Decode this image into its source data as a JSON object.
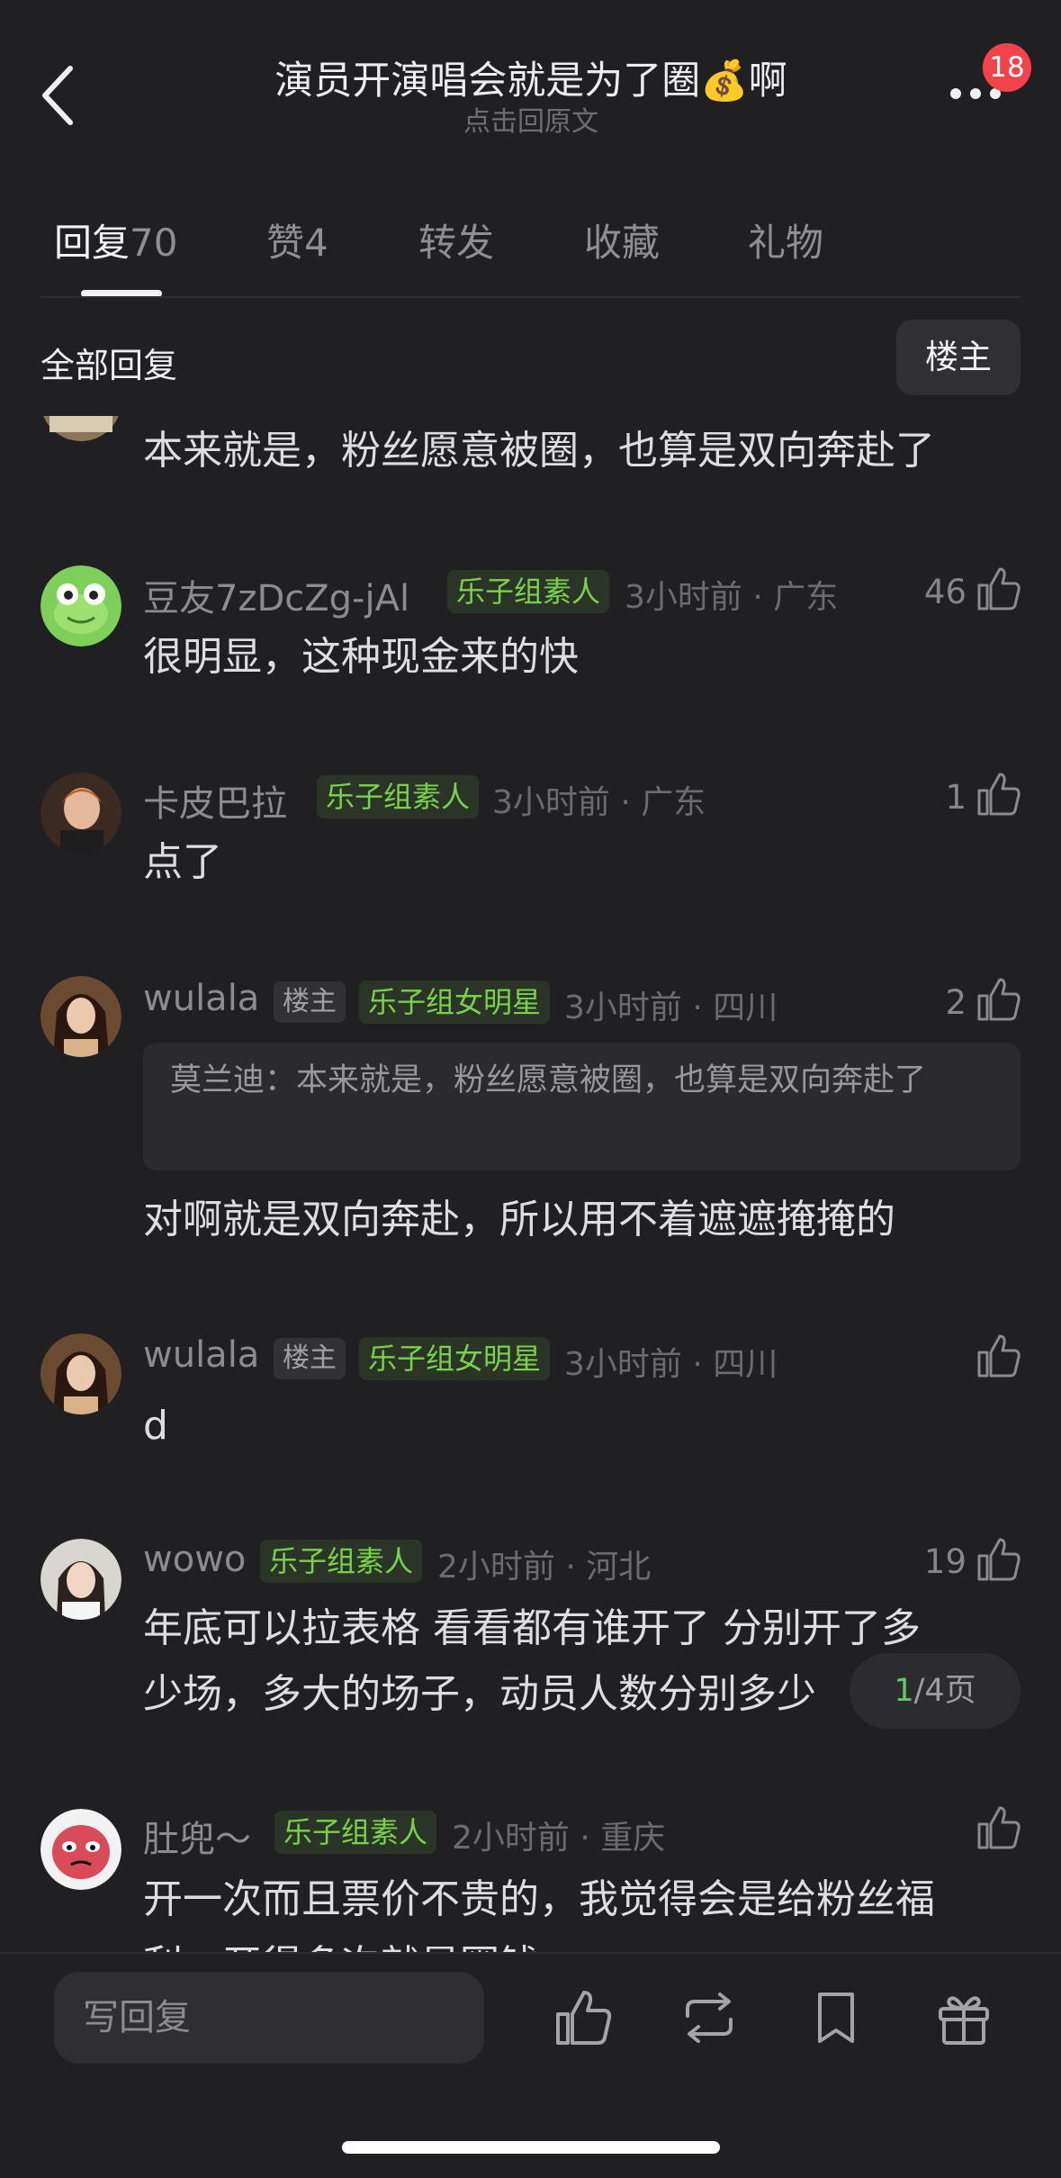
{
  "header": {
    "title": "演员开演唱会就是为了圈💰啊",
    "subtitle": "点击回原文",
    "notification_count": "18"
  },
  "tabs": [
    {
      "label": "回复",
      "count": "70",
      "active": true
    },
    {
      "label": "赞",
      "count": "4",
      "active": false
    },
    {
      "label": "转发",
      "count": "",
      "active": false
    },
    {
      "label": "收藏",
      "count": "",
      "active": false
    },
    {
      "label": "礼物",
      "count": "",
      "active": false
    }
  ],
  "section": {
    "title": "全部回复",
    "op_filter_label": "楼主"
  },
  "comments": [
    {
      "user": "",
      "text": "本来就是，粉丝愿意被圈，也算是双向奔赴了",
      "avatar": "partial-avatar"
    },
    {
      "user": "豆友7zDcZg-jAl",
      "tag": "乐子组素人",
      "meta": "3小时前 · 广东",
      "likes": "46",
      "text": "很明显，这种现金来的快",
      "avatar": "frog-avatar"
    },
    {
      "user": "卡皮巴拉",
      "tag": "乐子组素人",
      "meta": "3小时前 · 广东",
      "likes": "1",
      "text": "点了",
      "avatar": "photo-avatar"
    },
    {
      "user": "wulala",
      "op_tag": "楼主",
      "tag": "乐子组女明星",
      "meta": "3小时前 · 四川",
      "likes": "2",
      "quote": "莫兰迪：本来就是，粉丝愿意被圈，也算是双向奔赴了",
      "text": "对啊就是双向奔赴，所以用不着遮遮掩掩的",
      "avatar": "photo-avatar"
    },
    {
      "user": "wulala",
      "op_tag": "楼主",
      "tag": "乐子组女明星",
      "meta": "3小时前 · 四川",
      "likes": "",
      "text": "d",
      "avatar": "photo-avatar"
    },
    {
      "user": "wowo",
      "tag": "乐子组素人",
      "meta": "2小时前 · 河北",
      "likes": "19",
      "text_line1": "年底可以拉表格 看看都有谁开了 分别开了多",
      "text_line2": "少场，多大的场子，动员人数分别多少",
      "avatar": "photo-avatar"
    },
    {
      "user": "肚兜～",
      "tag": "乐子组素人",
      "meta": "2小时前 · 重庆",
      "likes": "",
      "text_line1": "开一次而且票价不贵的，我觉得会是给粉丝福",
      "text_line2": "利，开得多次就是圈钱",
      "avatar": "meme-avatar"
    }
  ],
  "pager": {
    "current": "1",
    "total_label": "/4页"
  },
  "bottom_bar": {
    "reply_placeholder": "写回复"
  },
  "colors": {
    "background": "#202023",
    "tag_green": "#7ad14b",
    "badge_red": "#f2434b"
  }
}
